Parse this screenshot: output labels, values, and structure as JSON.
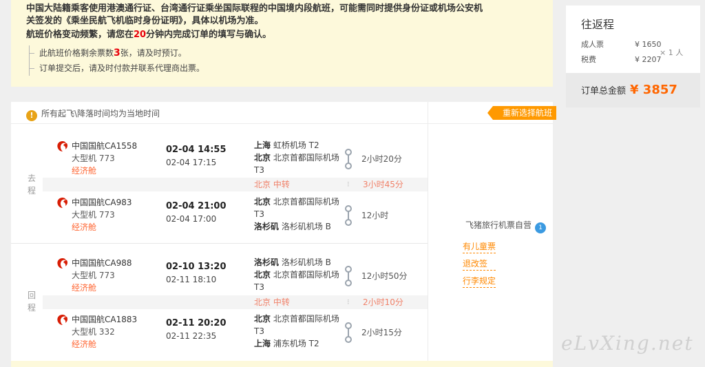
{
  "notice": {
    "line1": "中国大陆籍乘客使用港澳通行证、台湾通行证乘坐国际联程的中国境内段航班，可能需同时提供身份证或机场公安机",
    "line2": "关签发的《乘坐民航飞机临时身份证明》，具体以机场为准。",
    "warn_pre": "航班价格变动频繁，请您在",
    "warn_num": "20",
    "warn_post": "分钟内完成订单的填写与确认。",
    "bullet1_pre": "此航班价格剩余票数",
    "bullet1_num": "3",
    "bullet1_post": "张，请及时预订。",
    "bullet2": "订单提交后，请及时付款并联系代理商出票。"
  },
  "summary": {
    "title": "往返程",
    "adult_label": "成人票",
    "adult_price": "¥ 1650",
    "tax_label": "税费",
    "tax_price": "¥ 2207",
    "multiplier": "× 1 人",
    "total_label": "订单总金额",
    "total_amount": "¥ 3857"
  },
  "panel": {
    "time_note": "所有起飞\\降落时间均为当地时间",
    "reselect": "重新选择航班",
    "dir_out_1": "去",
    "dir_out_2": "程",
    "dir_ret_1": "回",
    "dir_ret_2": "程",
    "seller": "飞猪旅行机票自营",
    "links": [
      "有儿童票",
      "退改签",
      "行李规定"
    ]
  },
  "legs": [
    {
      "airline": "中国国航CA1558",
      "plane": "大型机 773",
      "cabin": "经济舱",
      "dep": "02-04 14:55",
      "arr": "02-04 17:15",
      "from_city": "上海",
      "from_ap": "虹桥机场 T2",
      "to_city": "北京",
      "to_ap": "北京首都国际机场 T3",
      "duration": "2小时20分"
    },
    {
      "airline": "中国国航CA983",
      "plane": "大型机 773",
      "cabin": "经济舱",
      "dep": "02-04 21:00",
      "arr": "02-04 17:00",
      "from_city": "北京",
      "from_ap": "北京首都国际机场 T3",
      "to_city": "洛杉矶",
      "to_ap": "洛杉矶机场 B",
      "duration": "12小时"
    },
    {
      "airline": "中国国航CA988",
      "plane": "大型机 773",
      "cabin": "经济舱",
      "dep": "02-10 13:20",
      "arr": "02-11 18:10",
      "from_city": "洛杉矶",
      "from_ap": "洛杉矶机场 B",
      "to_city": "北京",
      "to_ap": "北京首都国际机场 T3",
      "duration": "12小时50分"
    },
    {
      "airline": "中国国航CA1883",
      "plane": "大型机 332",
      "cabin": "经济舱",
      "dep": "02-11 20:20",
      "arr": "02-11 22:35",
      "from_city": "北京",
      "from_ap": "北京首都国际机场 T3",
      "to_city": "上海",
      "to_ap": "浦东机场 T2",
      "duration": "2小时15分"
    }
  ],
  "transfers": [
    {
      "city": "北京 中转",
      "layover": "3小时45分"
    },
    {
      "city": "北京 中转",
      "layover": "2小时10分"
    }
  ],
  "watermark": "eLvXing.net",
  "colors": {
    "accent": "#ff6600",
    "notice_bg": "#fdf9db",
    "badge_bg": "#ff9900",
    "warn_red": "#e8000b"
  }
}
